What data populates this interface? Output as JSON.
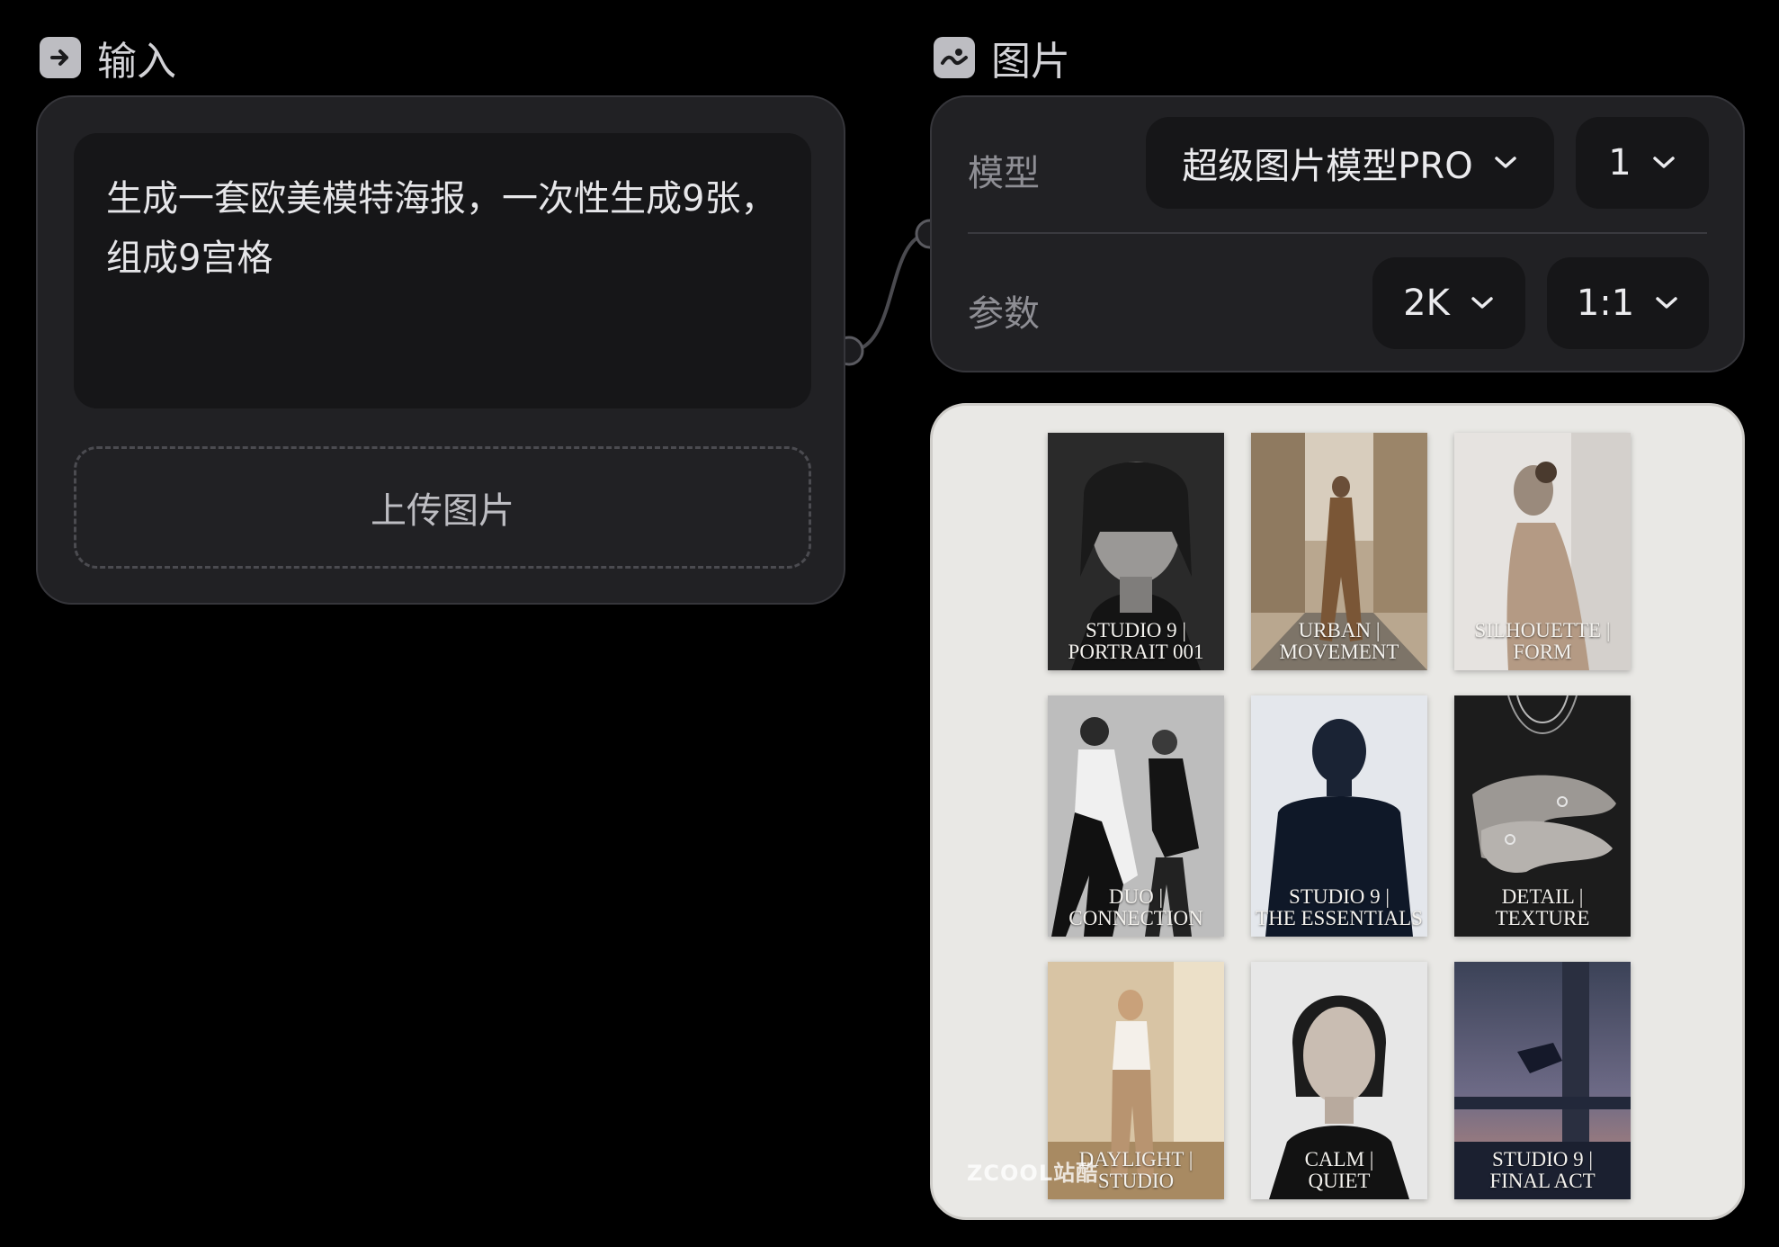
{
  "input_node": {
    "title": "输入",
    "prompt": "生成一套欧美模特海报，一次性生成9张，组成9宫格",
    "upload_label": "上传图片"
  },
  "image_node": {
    "title": "图片",
    "model_label": "模型",
    "model_value": "超级图片模型PRO",
    "count_value": "1",
    "params_label": "参数",
    "resolution_value": "2K",
    "ratio_value": "1:1"
  },
  "result": {
    "tiles": [
      {
        "caption": "STUDIO 9 |\nPORTRAIT 001"
      },
      {
        "caption": "URBAN |\nMOVEMENT"
      },
      {
        "caption": "SILHOUETTE |\nFORM"
      },
      {
        "caption": "DUO |\nCONNECTION"
      },
      {
        "caption": "STUDIO 9 |\nTHE ESSENTIALS"
      },
      {
        "caption": "DETAIL |\nTEXTURE"
      },
      {
        "caption": "DAYLIGHT |\nSTUDIO"
      },
      {
        "caption": "CALM |\nQUIET"
      },
      {
        "caption": "STUDIO 9 |\nFINAL ACT"
      }
    ],
    "watermark": "ZCOOL站酷"
  },
  "colors": {
    "background": "#000000",
    "node": "#212124",
    "inner": "#161618",
    "card": "#e9e8e5"
  }
}
